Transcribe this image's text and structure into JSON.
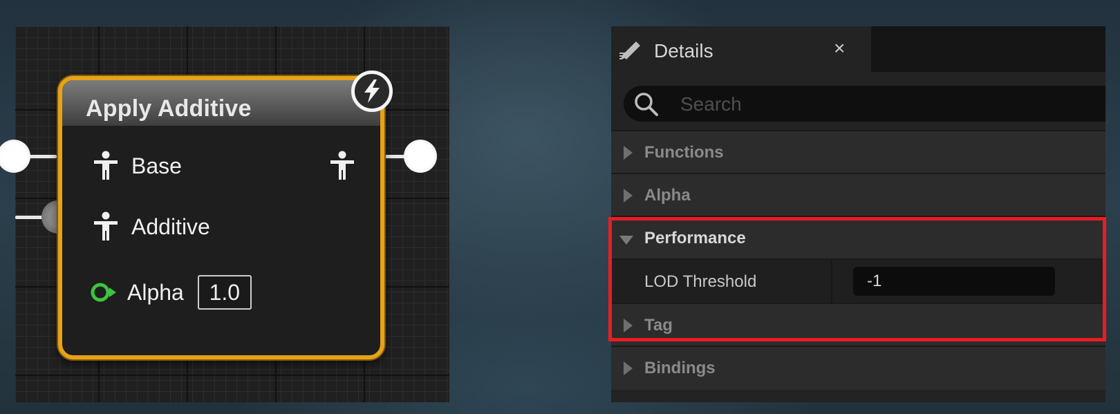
{
  "graph": {
    "node": {
      "title": "Apply Additive",
      "pins": [
        {
          "label": "Base",
          "icon": "pose-icon"
        },
        {
          "label": "Additive",
          "icon": "pose-icon"
        },
        {
          "label": "Alpha",
          "icon": "float-pin-icon",
          "value": "1.0"
        }
      ],
      "output_icon": "pose-icon",
      "badge_icon": "fast-path-lightning-icon"
    }
  },
  "details": {
    "tab_title": "Details",
    "close_glyph": "×",
    "search_placeholder": "Search",
    "categories": [
      {
        "label": "Functions",
        "expanded": false
      },
      {
        "label": "Alpha",
        "expanded": false
      },
      {
        "label": "Performance",
        "expanded": true
      },
      {
        "label": "Tag",
        "expanded": false
      },
      {
        "label": "Bindings",
        "expanded": false
      }
    ],
    "lod_threshold": {
      "label": "LOD Threshold",
      "value": "-1"
    }
  },
  "colors": {
    "node_border": "#e7a217",
    "highlight": "#ea1d22",
    "float_pin": "#3ec33e"
  }
}
